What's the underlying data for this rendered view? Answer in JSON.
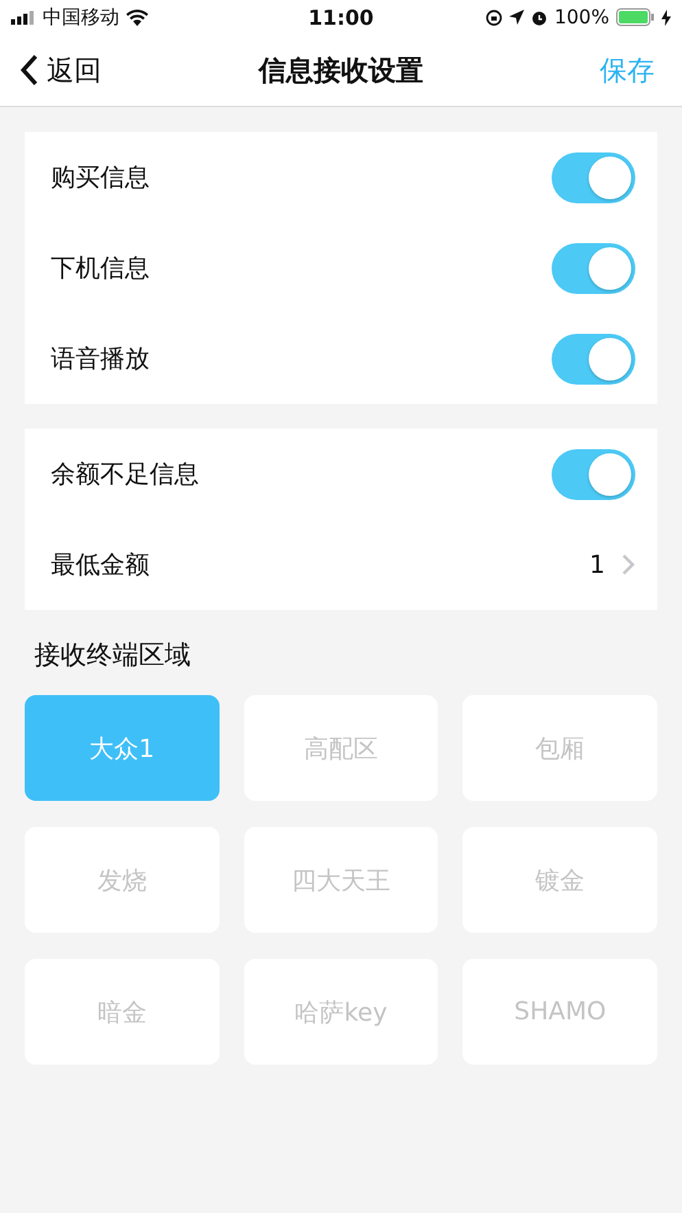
{
  "status_bar": {
    "carrier": "中国移动",
    "time": "11:00",
    "battery": "100%"
  },
  "nav": {
    "back": "返回",
    "title": "信息接收设置",
    "action": "保存"
  },
  "groups": [
    {
      "rows": [
        {
          "kind": "toggle",
          "label": "购买信息",
          "on": true
        },
        {
          "kind": "toggle",
          "label": "下机信息",
          "on": true
        },
        {
          "kind": "toggle",
          "label": "语音播放",
          "on": true
        }
      ]
    },
    {
      "rows": [
        {
          "kind": "toggle",
          "label": "余额不足信息",
          "on": true
        },
        {
          "kind": "value",
          "label": "最低金额",
          "value": "1"
        }
      ]
    }
  ],
  "areas": {
    "title": "接收终端区域",
    "items": [
      {
        "label": "大众1",
        "selected": true
      },
      {
        "label": "高配区",
        "selected": false
      },
      {
        "label": "包厢",
        "selected": false
      },
      {
        "label": "发烧",
        "selected": false
      },
      {
        "label": "四大天王",
        "selected": false
      },
      {
        "label": "镀金",
        "selected": false
      },
      {
        "label": "暗金",
        "selected": false
      },
      {
        "label": "哈萨key",
        "selected": false
      },
      {
        "label": "SHAMO",
        "selected": false
      }
    ]
  }
}
